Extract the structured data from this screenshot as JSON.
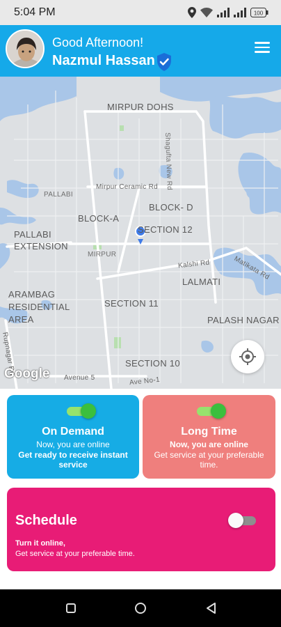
{
  "status_bar": {
    "time": "5:04 PM",
    "battery": "100",
    "icons": [
      "location-icon",
      "wifi-icon",
      "signal-icon",
      "signal-icon",
      "battery-icon"
    ]
  },
  "header": {
    "greeting": "Good Afternoon!",
    "user_name": "Nazmul Hassan",
    "verified_icon": "verified-badge-icon",
    "menu_icon": "hamburger-menu-icon",
    "background": "#15a9e9"
  },
  "map": {
    "labels": {
      "mirpur_dohs": "MIRPUR DOHS",
      "shagufta_road": "Shagufta New Rd",
      "mirpur_ceramic_rd": "Mirpur Ceramic Rd",
      "pallabi": "PALLABI",
      "block_a": "BLOCK-A",
      "block_d": "BLOCK- D",
      "section_12": "SECTION 12",
      "pallabi_extension": "PALLABI EXTENSION",
      "mirpur": "MIRPUR",
      "kalshi_rd": "Kalshi Rd",
      "matikata_rd": "Matikata Rd",
      "lalmati": "LALMATI",
      "arambag": "ARAMBAG RESIDENTIAL AREA",
      "section_11": "SECTION 11",
      "palash_nagar": "PALASH NAGAR",
      "section_10": "SECTION 10",
      "rupnagar_rd": "Rupnagar Rd",
      "avenue_5": "Avenue 5",
      "ave_no_1": "Ave No-1"
    },
    "google_logo": "Google",
    "location_button_icon": "my-location-icon"
  },
  "cards": {
    "on_demand": {
      "title": "On Demand",
      "line1": "Now, you are online",
      "line2": "Get ready to receive instant service",
      "toggle": "on",
      "color": "#16ace5"
    },
    "long_time": {
      "title": "Long Time",
      "line1": "Now, you are online",
      "line2": "Get service at your preferable time.",
      "toggle": "on",
      "color": "#ef7f7d"
    },
    "schedule": {
      "title": "Schedule",
      "line1": "Turn it online,",
      "line2": "Get service at your preferable time.",
      "toggle": "off",
      "color": "#e81c76"
    }
  },
  "nav_bar": {
    "buttons": [
      "recents-icon",
      "home-icon",
      "back-icon"
    ]
  }
}
